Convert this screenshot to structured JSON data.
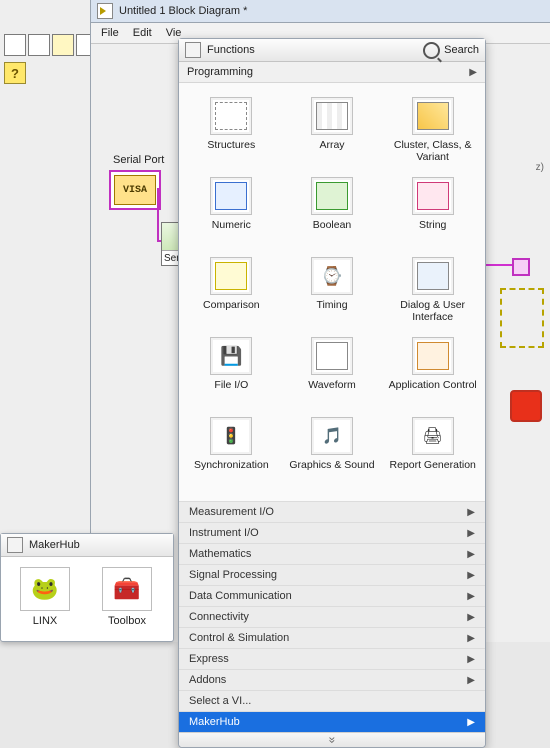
{
  "window": {
    "title": "Untitled 1 Block Diagram *",
    "menu": {
      "file": "File",
      "edit": "Edit",
      "view": "Vie"
    }
  },
  "diagram": {
    "serial_port_label": "Serial Port",
    "visa_text": "VISA",
    "sub_caption": "Seri"
  },
  "tools": {
    "help_glyph": "?"
  },
  "functions_palette": {
    "title": "Functions",
    "search_label": "Search",
    "section": "Programming",
    "items": [
      {
        "label": "Structures"
      },
      {
        "label": "Array"
      },
      {
        "label": "Cluster, Class, & Variant"
      },
      {
        "label": "Numeric"
      },
      {
        "label": "Boolean"
      },
      {
        "label": "String"
      },
      {
        "label": "Comparison"
      },
      {
        "label": "Timing"
      },
      {
        "label": "Dialog & User Interface"
      },
      {
        "label": "File I/O"
      },
      {
        "label": "Waveform"
      },
      {
        "label": "Application Control"
      },
      {
        "label": "Synchronization"
      },
      {
        "label": "Graphics & Sound"
      },
      {
        "label": "Report Generation"
      }
    ],
    "categories": [
      {
        "label": "Measurement I/O",
        "sub": true
      },
      {
        "label": "Instrument I/O",
        "sub": true
      },
      {
        "label": "Mathematics",
        "sub": true
      },
      {
        "label": "Signal Processing",
        "sub": true
      },
      {
        "label": "Data Communication",
        "sub": true
      },
      {
        "label": "Connectivity",
        "sub": true
      },
      {
        "label": "Control & Simulation",
        "sub": true
      },
      {
        "label": "Express",
        "sub": true
      },
      {
        "label": "Addons",
        "sub": true
      },
      {
        "label": "Select a VI...",
        "sub": false
      },
      {
        "label": "MakerHub",
        "sub": true,
        "selected": true
      }
    ],
    "expand_glyph": "»"
  },
  "makerhub_palette": {
    "title": "MakerHub",
    "items": [
      {
        "label": "LINX",
        "icon": "🐸"
      },
      {
        "label": "Toolbox",
        "icon": "🧰"
      }
    ]
  },
  "right": {
    "hz_label": "z)"
  }
}
